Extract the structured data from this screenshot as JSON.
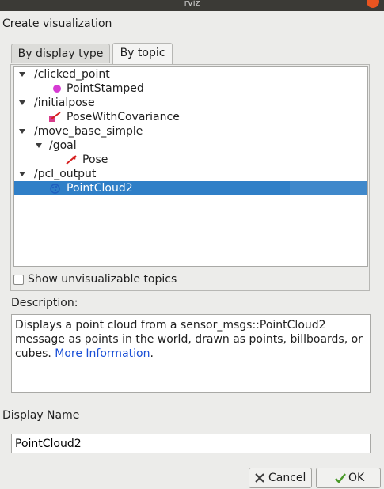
{
  "window": {
    "title": "rviz"
  },
  "section": {
    "title": "Create visualization"
  },
  "tabs": [
    {
      "label": "By display type",
      "active": false
    },
    {
      "label": "By topic",
      "active": true
    }
  ],
  "tree": {
    "rows": [
      {
        "label": "/clicked_point",
        "type": "topic",
        "expanded": true
      },
      {
        "label": "PointStamped",
        "type": "display",
        "icon": "point-stamped-icon"
      },
      {
        "label": "/initialpose",
        "type": "topic",
        "expanded": true
      },
      {
        "label": "PoseWithCovariance",
        "type": "display",
        "icon": "pose-with-covariance-icon"
      },
      {
        "label": "/move_base_simple",
        "type": "topic",
        "expanded": true
      },
      {
        "label": "/goal",
        "type": "topic",
        "expanded": true
      },
      {
        "label": "Pose",
        "type": "display",
        "icon": "pose-icon"
      },
      {
        "label": "/pcl_output",
        "type": "topic",
        "expanded": true
      },
      {
        "label": "PointCloud2",
        "type": "display",
        "icon": "point-cloud-icon",
        "selected": true
      }
    ]
  },
  "show_unvisualizable": {
    "label": "Show unvisualizable topics",
    "checked": false
  },
  "description": {
    "heading": "Description:",
    "text": "Displays a point cloud from a sensor_msgs::PointCloud2 message as points in the world, drawn as points, billboards, or cubes. ",
    "link_text": "More Information",
    "trailing": "."
  },
  "display_name": {
    "heading": "Display Name",
    "value": "PointCloud2"
  },
  "buttons": {
    "cancel_label": "Cancel",
    "ok_label": "OK"
  },
  "colors": {
    "selection": "#2f7fc7",
    "link": "#1a4fd6",
    "accent": "#e95420"
  }
}
